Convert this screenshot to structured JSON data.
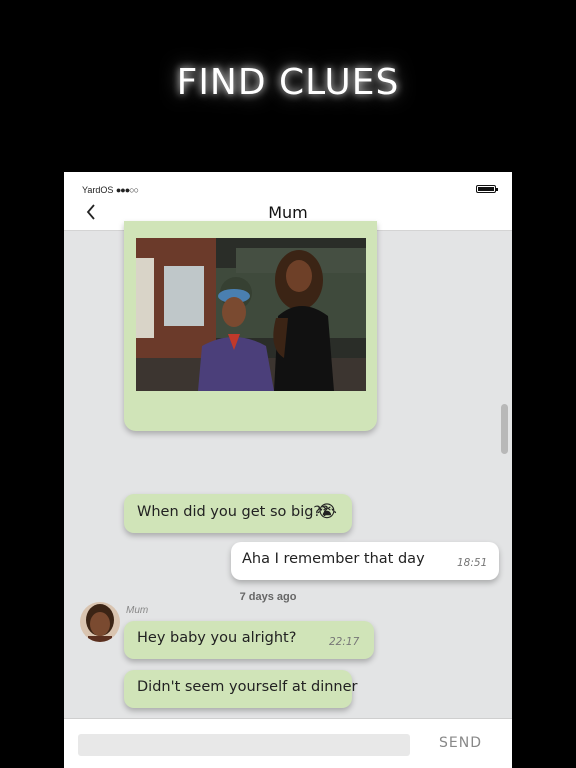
{
  "promo": {
    "headline": "FIND CLUES"
  },
  "status_bar": {
    "carrier": "YardOS",
    "signal_dots": "●●●○○",
    "battery_level": 1.0
  },
  "nav": {
    "back_icon": "chevron-left-icon",
    "title": "Mum"
  },
  "messages": [
    {
      "type": "image",
      "direction": "incoming",
      "alt": "photo-attachment"
    },
    {
      "type": "text",
      "direction": "incoming",
      "text": "When did you get so big??",
      "emoji": "😭"
    },
    {
      "type": "text",
      "direction": "outgoing",
      "text": "Aha I remember that day",
      "time": "18:51"
    },
    {
      "type": "divider",
      "text": "7 days ago"
    },
    {
      "type": "text",
      "direction": "incoming",
      "sender": "Mum",
      "text": "Hey baby you alright?",
      "time": "22:17"
    },
    {
      "type": "text",
      "direction": "incoming",
      "text": "Didn't seem yourself at dinner"
    }
  ],
  "composer": {
    "placeholder": "",
    "value": "",
    "send_label": "SEND"
  },
  "colors": {
    "incoming_bubble": "#d0e4b8",
    "outgoing_bubble": "#ffffff",
    "chat_background": "#e3e4e5"
  }
}
